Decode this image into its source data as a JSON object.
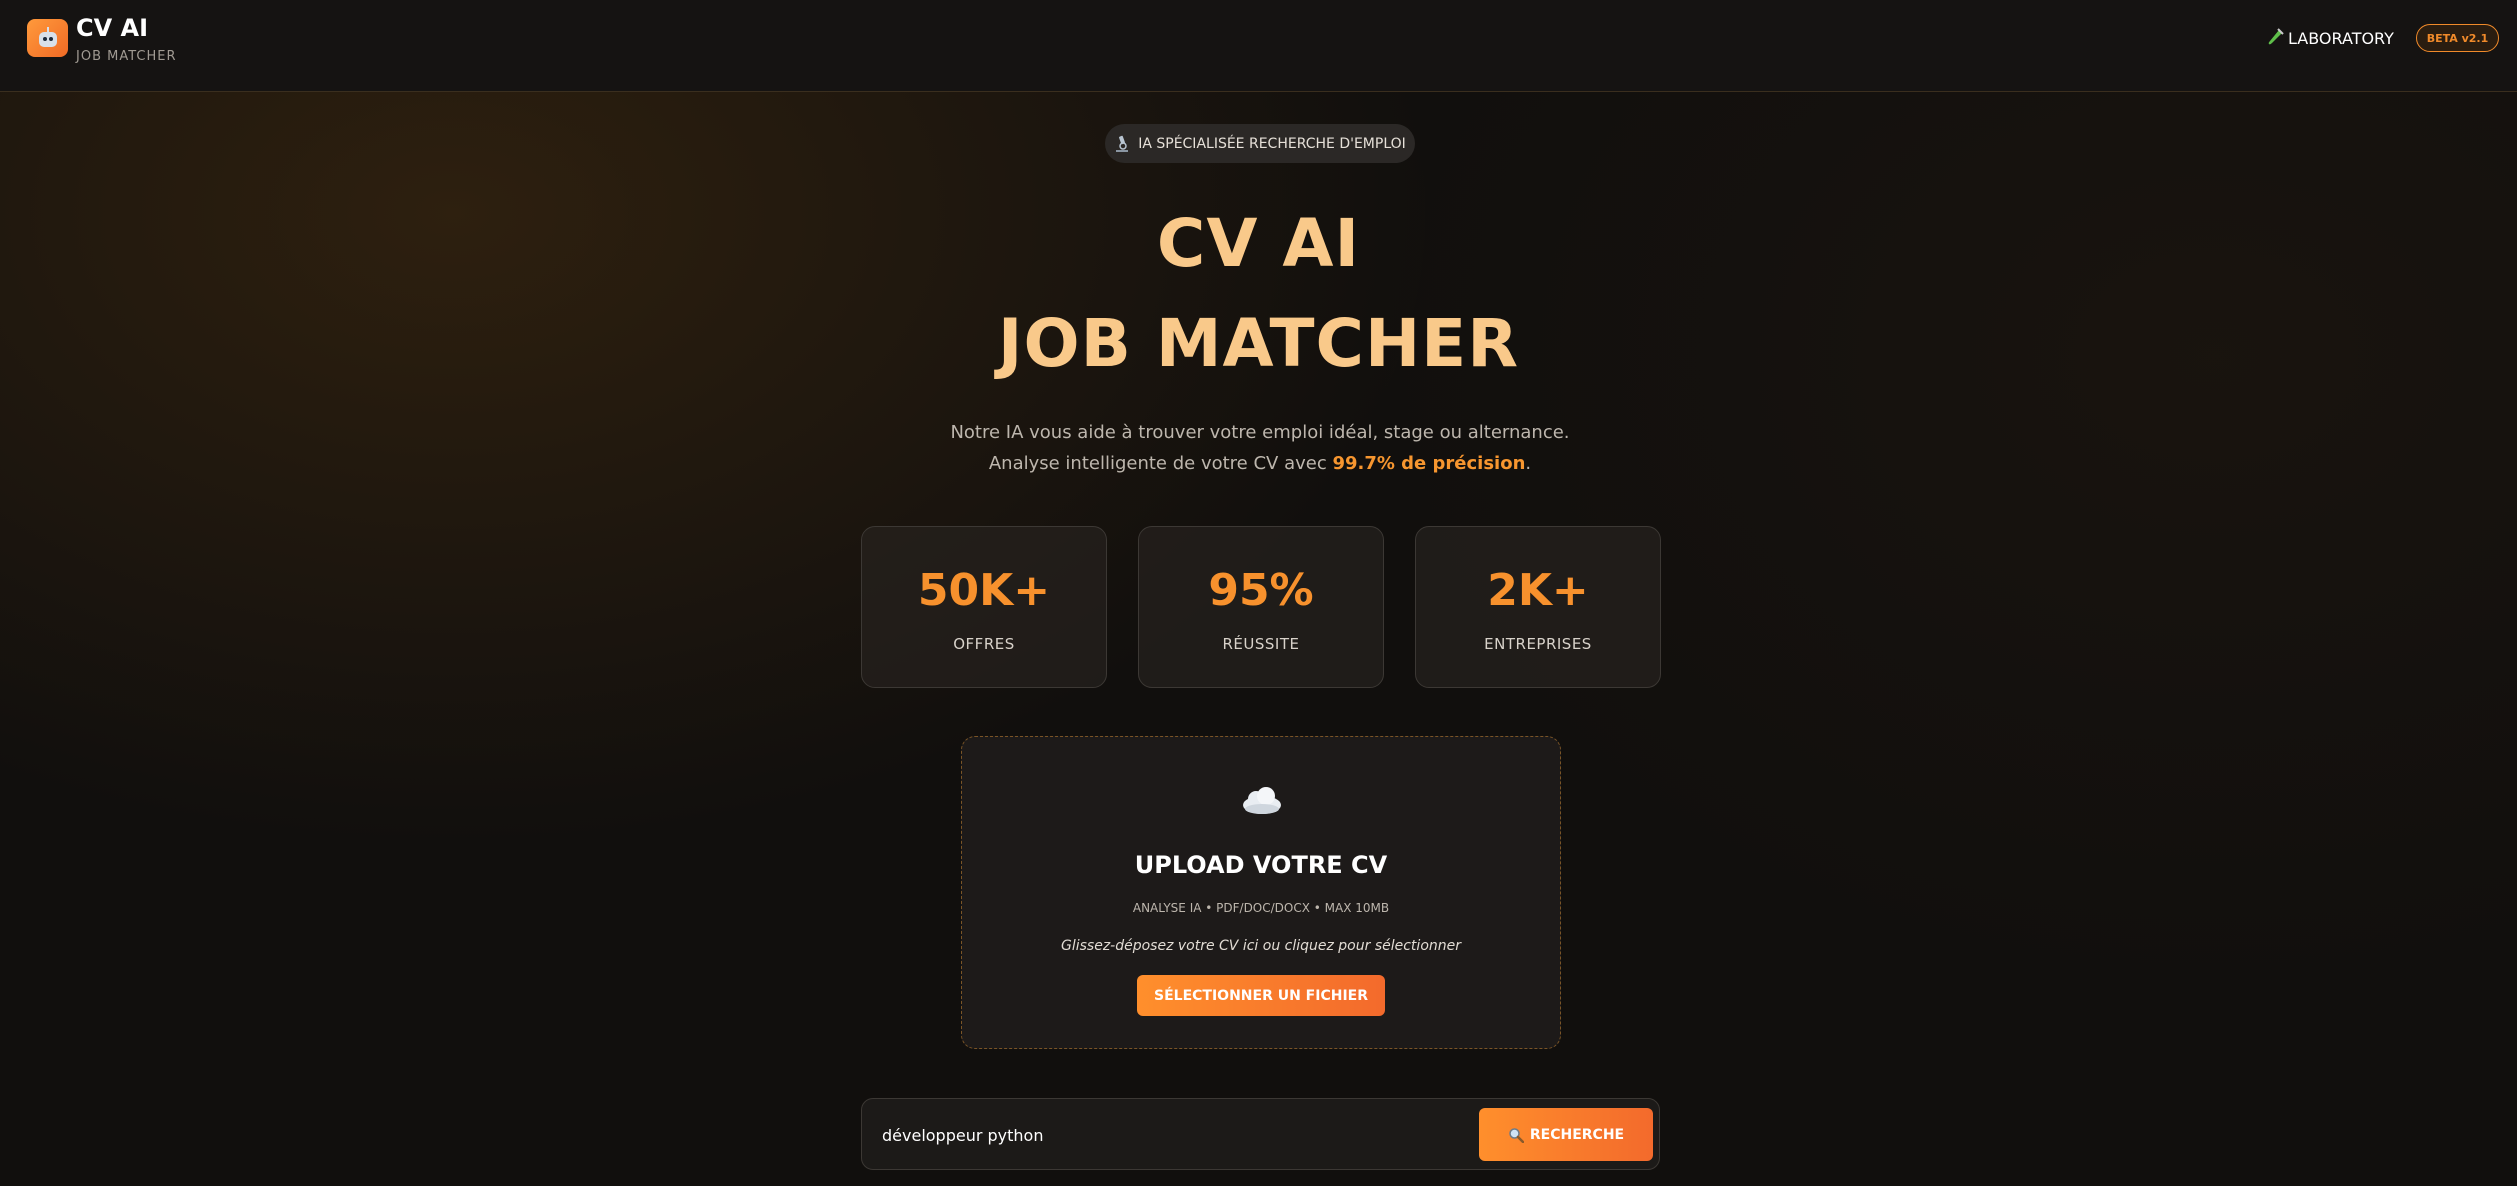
{
  "header": {
    "brand_title": "CV AI",
    "brand_subtitle": "JOB MATCHER",
    "lab_label": "LABORATORY",
    "beta_badge": "BETA v2.1"
  },
  "hero": {
    "pill_label": "IA SPÉCIALISÉE RECHERCHE D'EMPLOI",
    "title_line1": "CV AI",
    "title_line2": "JOB MATCHER",
    "description_before": "Notre IA vous aide à trouver votre emploi idéal, stage ou alternance. Analyse intelligente de votre CV avec ",
    "description_highlight": "99.7% de précision",
    "description_after": "."
  },
  "stats": [
    {
      "value": "50K+",
      "label": "OFFRES"
    },
    {
      "value": "95%",
      "label": "RÉUSSITE"
    },
    {
      "value": "2K+",
      "label": "ENTREPRISES"
    }
  ],
  "upload": {
    "icon": "cloud-icon",
    "title": "UPLOAD VOTRE CV",
    "meta": "ANALYSE IA • PDF/DOC/DOCX • MAX 10MB",
    "hint": "Glissez-déposez votre CV ici ou cliquez pour sélectionner",
    "button_label": "SÉLECTIONNER UN FICHIER"
  },
  "search": {
    "value": "développeur python",
    "button_label": "RECHERCHE"
  },
  "colors": {
    "accent": "#f7912d",
    "title": "#f9c98a",
    "background": "#110f0d"
  }
}
